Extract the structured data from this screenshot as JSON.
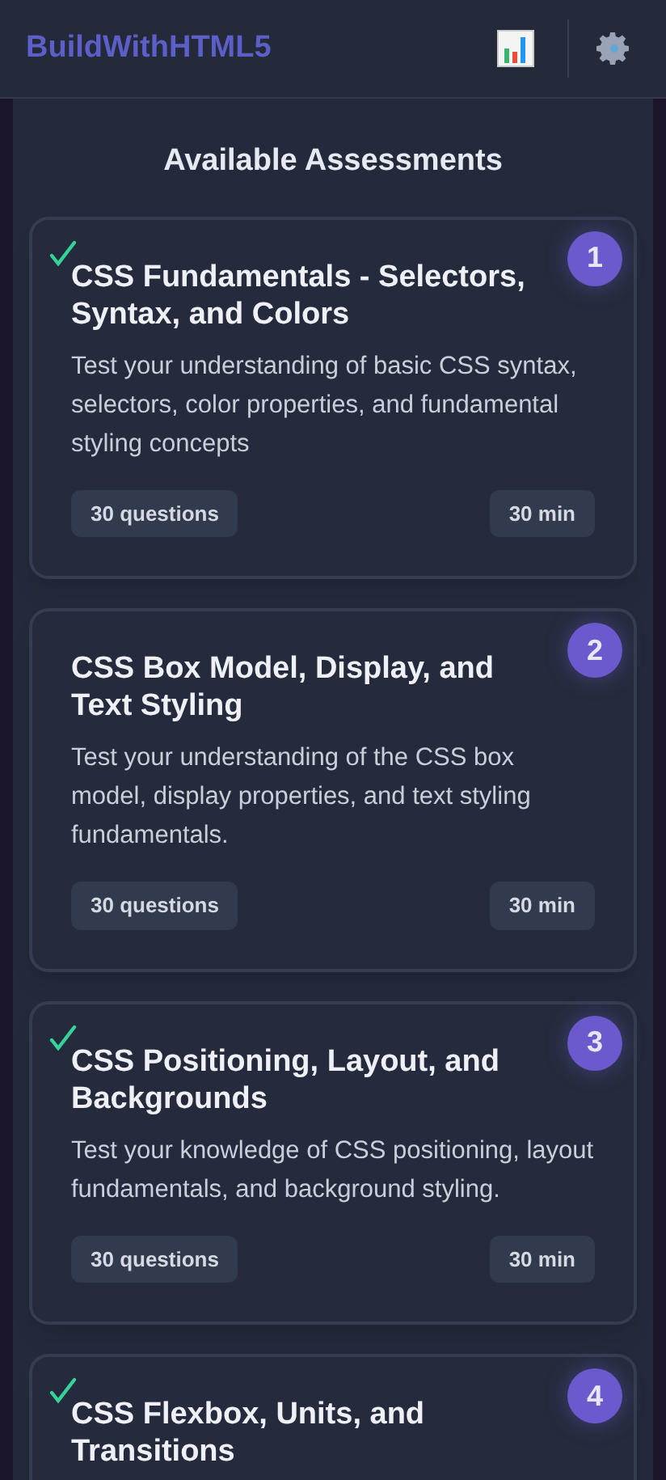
{
  "header": {
    "logo": "BuildWithHTML5"
  },
  "section_title": "Available Assessments",
  "assessments": [
    {
      "number": "1",
      "completed": true,
      "title": "CSS Fundamentals - Selectors, Syntax, and Colors",
      "description": "Test your understanding of basic CSS syntax, selectors, color properties, and fundamental styling concepts",
      "questions": "30 questions",
      "duration": "30 min"
    },
    {
      "number": "2",
      "completed": false,
      "title": "CSS Box Model, Display, and Text Styling",
      "description": "Test your understanding of the CSS box model, display properties, and text styling fundamentals.",
      "questions": "30 questions",
      "duration": "30 min"
    },
    {
      "number": "3",
      "completed": true,
      "title": "CSS Positioning, Layout, and Backgrounds",
      "description": "Test your knowledge of CSS positioning, layout fundamentals, and background styling.",
      "questions": "30 questions",
      "duration": "30 min"
    },
    {
      "number": "4",
      "completed": true,
      "title": "CSS Flexbox, Units, and Transitions"
    }
  ]
}
